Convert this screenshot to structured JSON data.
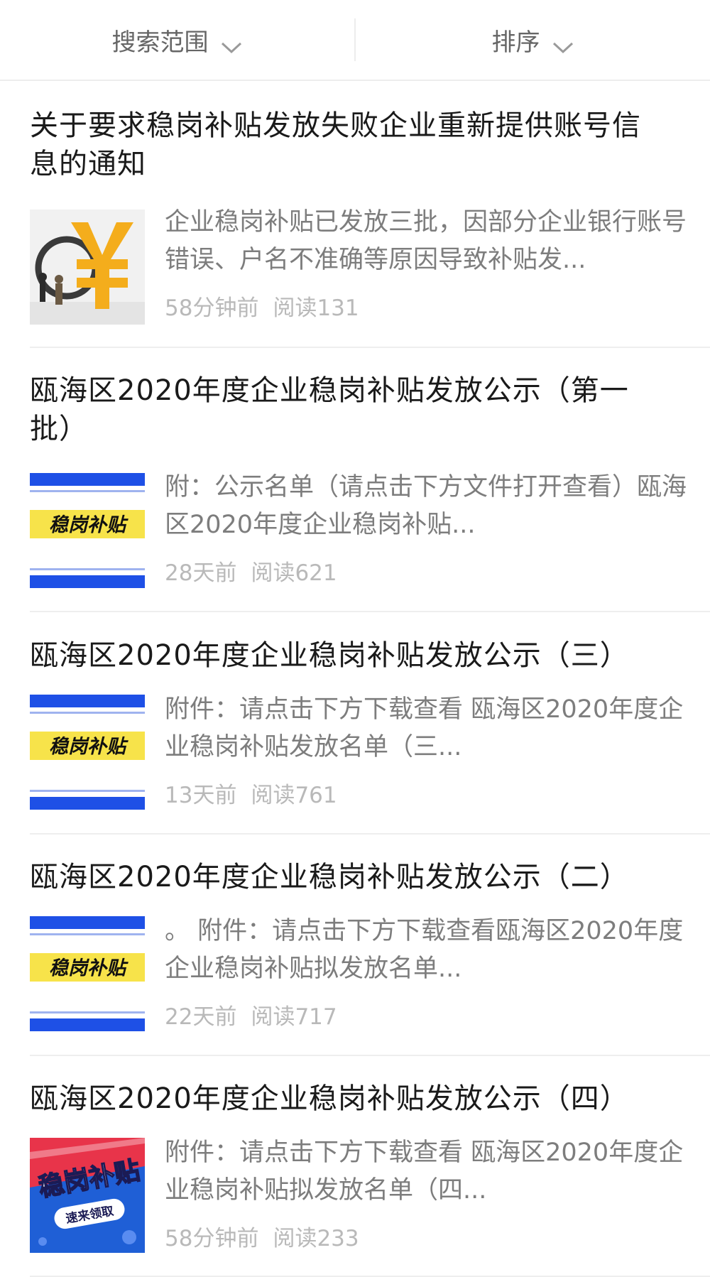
{
  "filter": {
    "scope_label": "搜索范围",
    "sort_label": "排序"
  },
  "articles": [
    {
      "title": "关于要求稳岗补贴发放失败企业重新提供账号信息的通知",
      "snippet": "企业稳岗补贴已发放三批，因部分企业银行账号错误、户名不准确等原因导致补贴发...",
      "time": "58分钟前",
      "reads": "阅读131",
      "thumb_icon": "yen-coin-image"
    },
    {
      "title": "瓯海区2020年度企业稳岗补贴发放公示（第一批）",
      "snippet": "附：公示名单（请点击下方文件打开查看）瓯海区2020年度企业稳岗补贴...",
      "time": "28天前",
      "reads": "阅读621",
      "thumb_text": "稳岗补贴"
    },
    {
      "title": "瓯海区2020年度企业稳岗补贴发放公示（三）",
      "snippet": "附件：请点击下方下载查看 瓯海区2020年度企业稳岗补贴发放名单（三...",
      "time": "13天前",
      "reads": "阅读761",
      "thumb_text": "稳岗补贴"
    },
    {
      "title": "瓯海区2020年度企业稳岗补贴发放公示（二）",
      "snippet": "。 附件：请点击下方下载查看瓯海区2020年度企业稳岗补贴拟发放名单...",
      "time": "22天前",
      "reads": "阅读717",
      "thumb_text": "稳岗补贴"
    },
    {
      "title": "瓯海区2020年度企业稳岗补贴发放公示（四）",
      "snippet": "附件：请点击下方下载查看 瓯海区2020年度企业稳岗补贴拟发放名单（四...",
      "time": "58分钟前",
      "reads": "阅读233",
      "thumb_text": "稳岗补贴",
      "thumb_subtext": "速来领取"
    }
  ],
  "colors": {
    "banner_blue": "#1e50e6",
    "banner_yellow": "#f7e34a",
    "coin_gold": "#f4ad1c",
    "poster_red": "#e8344a"
  }
}
